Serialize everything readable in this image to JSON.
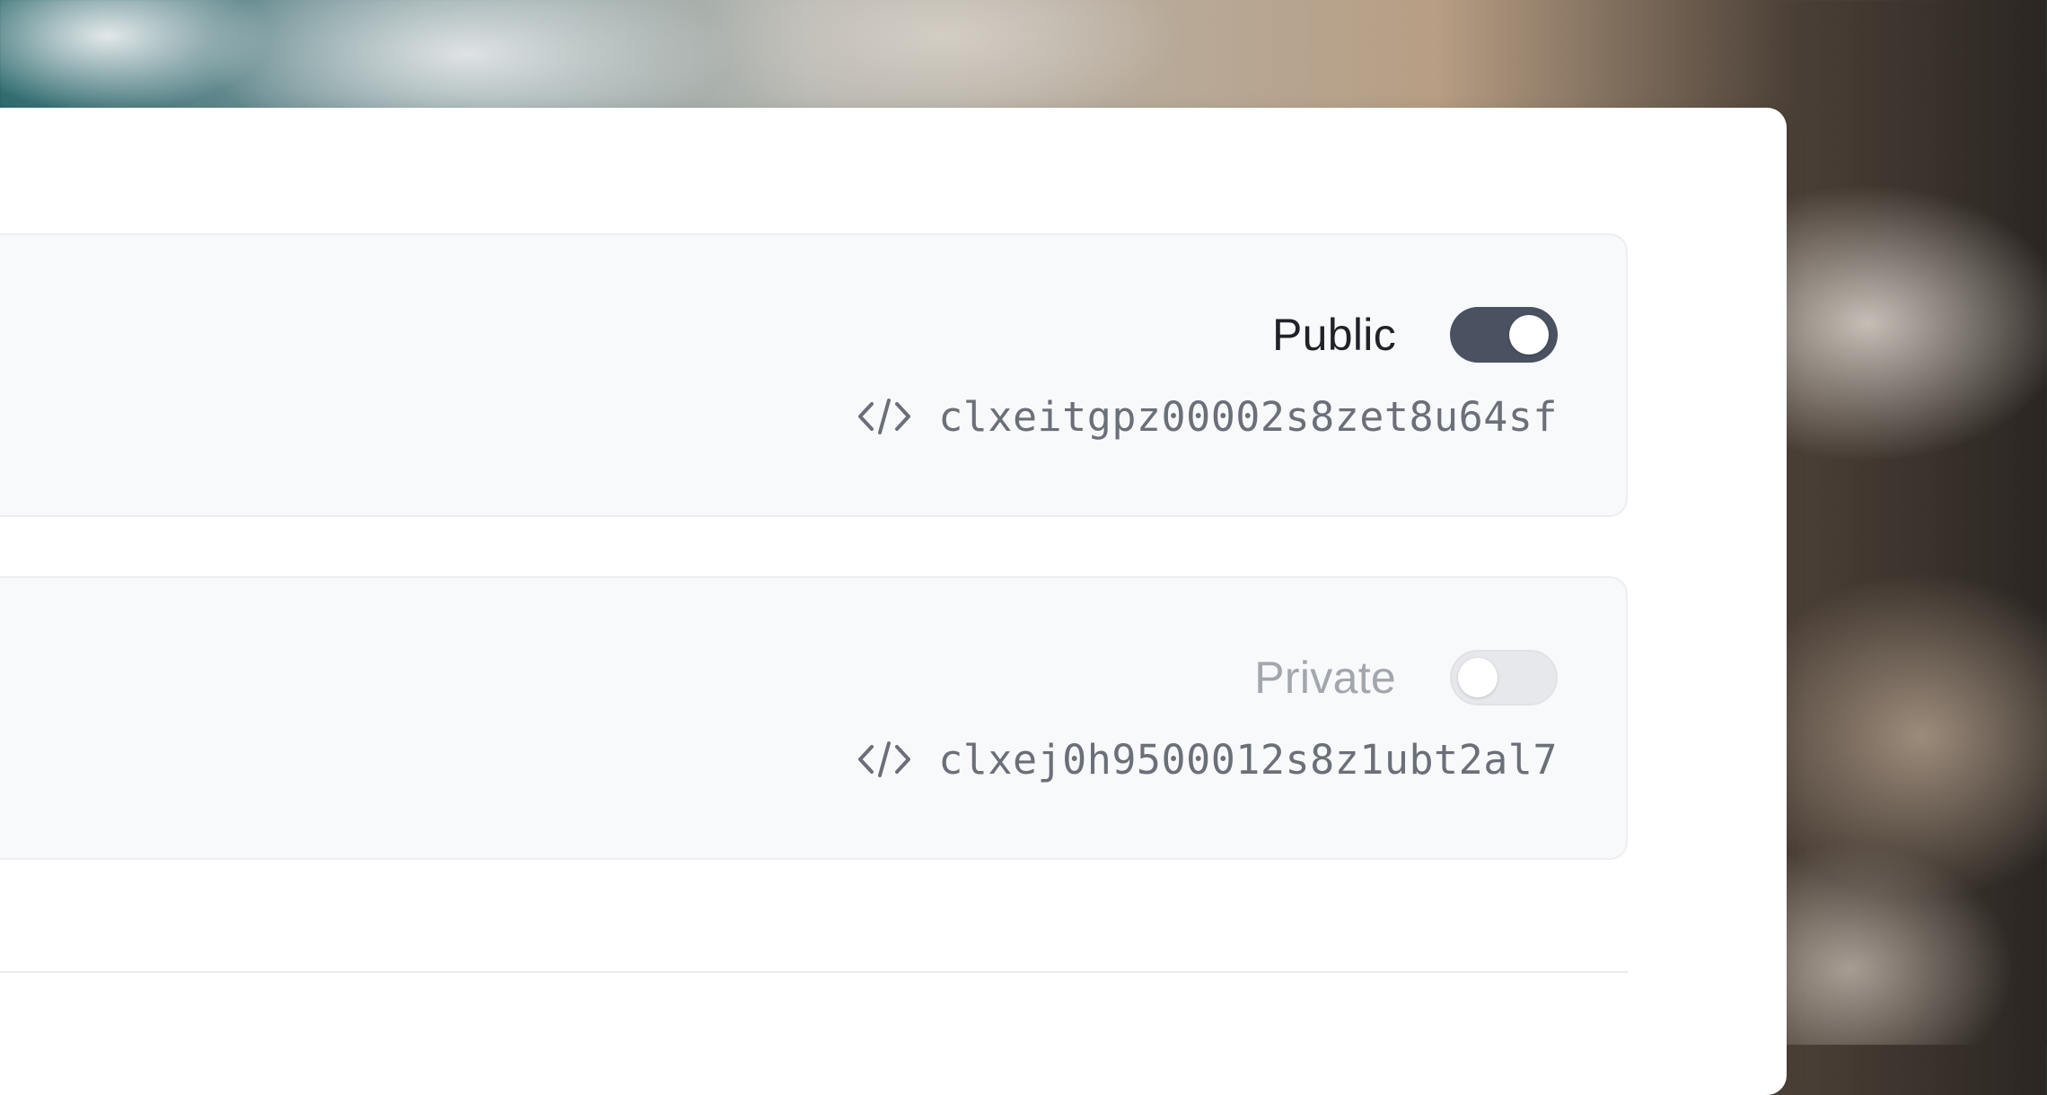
{
  "forms": [
    {
      "status_label": "Public",
      "enabled": true,
      "form_id": "clxeitgpz00002s8zet8u64sf"
    },
    {
      "status_label": "Private",
      "enabled": false,
      "form_id": "clxej0h9500012s8z1ubt2al7"
    }
  ],
  "icons": {
    "code": "code-brackets-icon"
  },
  "colors": {
    "toggle_on": "#4a5160",
    "toggle_off": "#e7e8eb",
    "row_bg": "#f8f9fb"
  }
}
